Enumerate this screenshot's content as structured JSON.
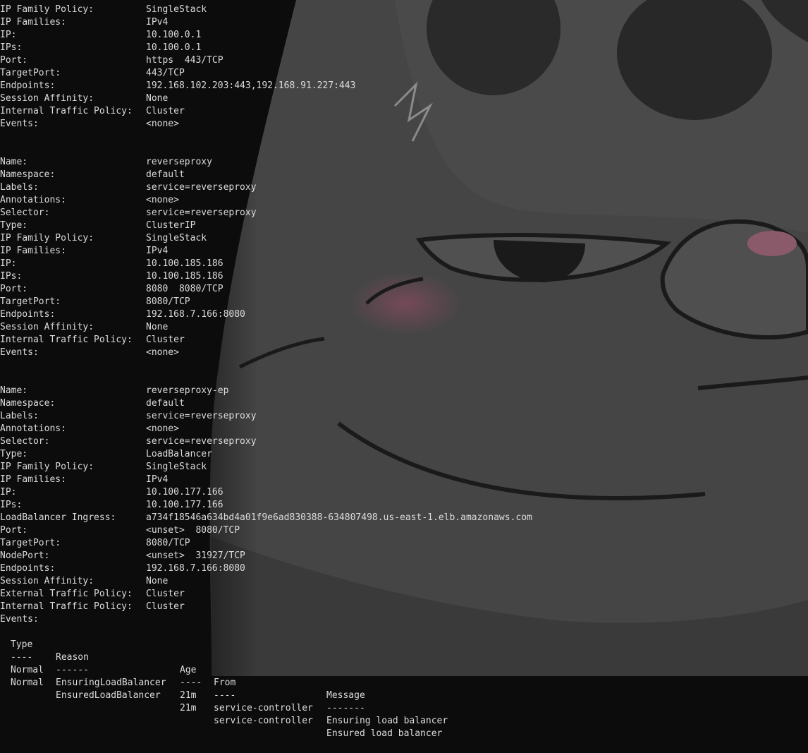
{
  "block1": [
    {
      "k": "IP Family Policy:",
      "v": "SingleStack"
    },
    {
      "k": "IP Families:",
      "v": "IPv4"
    },
    {
      "k": "IP:",
      "v": "10.100.0.1"
    },
    {
      "k": "IPs:",
      "v": "10.100.0.1"
    },
    {
      "k": "Port:",
      "v": "https  443/TCP"
    },
    {
      "k": "TargetPort:",
      "v": "443/TCP"
    },
    {
      "k": "Endpoints:",
      "v": "192.168.102.203:443,192.168.91.227:443"
    },
    {
      "k": "Session Affinity:",
      "v": "None"
    },
    {
      "k": "Internal Traffic Policy:",
      "v": "Cluster"
    },
    {
      "k": "Events:",
      "v": "<none>"
    }
  ],
  "block2": [
    {
      "k": "Name:",
      "v": "reverseproxy"
    },
    {
      "k": "Namespace:",
      "v": "default"
    },
    {
      "k": "Labels:",
      "v": "service=reverseproxy"
    },
    {
      "k": "Annotations:",
      "v": "<none>"
    },
    {
      "k": "Selector:",
      "v": "service=reverseproxy"
    },
    {
      "k": "Type:",
      "v": "ClusterIP"
    },
    {
      "k": "IP Family Policy:",
      "v": "SingleStack"
    },
    {
      "k": "IP Families:",
      "v": "IPv4"
    },
    {
      "k": "IP:",
      "v": "10.100.185.186"
    },
    {
      "k": "IPs:",
      "v": "10.100.185.186"
    },
    {
      "k": "Port:",
      "v": "8080  8080/TCP"
    },
    {
      "k": "TargetPort:",
      "v": "8080/TCP"
    },
    {
      "k": "Endpoints:",
      "v": "192.168.7.166:8080"
    },
    {
      "k": "Session Affinity:",
      "v": "None"
    },
    {
      "k": "Internal Traffic Policy:",
      "v": "Cluster"
    },
    {
      "k": "Events:",
      "v": "<none>"
    }
  ],
  "block3": [
    {
      "k": "Name:",
      "v": "reverseproxy-ep"
    },
    {
      "k": "Namespace:",
      "v": "default"
    },
    {
      "k": "Labels:",
      "v": "service=reverseproxy"
    },
    {
      "k": "Annotations:",
      "v": "<none>"
    },
    {
      "k": "Selector:",
      "v": "service=reverseproxy"
    },
    {
      "k": "Type:",
      "v": "LoadBalancer"
    },
    {
      "k": "IP Family Policy:",
      "v": "SingleStack"
    },
    {
      "k": "IP Families:",
      "v": "IPv4"
    },
    {
      "k": "IP:",
      "v": "10.100.177.166"
    },
    {
      "k": "IPs:",
      "v": "10.100.177.166"
    },
    {
      "k": "LoadBalancer Ingress:",
      "v": "a734f18546a634bd4a01f9e6ad830388-634807498.us-east-1.elb.amazonaws.com"
    },
    {
      "k": "Port:",
      "v": "<unset>  8080/TCP"
    },
    {
      "k": "TargetPort:",
      "v": "8080/TCP"
    },
    {
      "k": "NodePort:",
      "v": "<unset>  31927/TCP"
    },
    {
      "k": "Endpoints:",
      "v": "192.168.7.166:8080"
    },
    {
      "k": "Session Affinity:",
      "v": "None"
    },
    {
      "k": "External Traffic Policy:",
      "v": "Cluster"
    },
    {
      "k": "Internal Traffic Policy:",
      "v": "Cluster"
    },
    {
      "k": "Events:",
      "v": ""
    }
  ],
  "events": {
    "header": [
      "Type",
      "Reason",
      "Age",
      "From",
      "Message"
    ],
    "divider": [
      "----",
      "------",
      "----",
      "----",
      "-------"
    ],
    "rows": [
      [
        "Normal",
        "EnsuringLoadBalancer",
        "21m",
        "service-controller",
        "Ensuring load balancer"
      ],
      [
        "Normal",
        "EnsuredLoadBalancer",
        "21m",
        "service-controller",
        "Ensured load balancer"
      ]
    ]
  },
  "background": {
    "image": "cat-face-illustration",
    "terminal_bg_color": "#0c0c0c",
    "text_color": "#dcdcdc"
  }
}
